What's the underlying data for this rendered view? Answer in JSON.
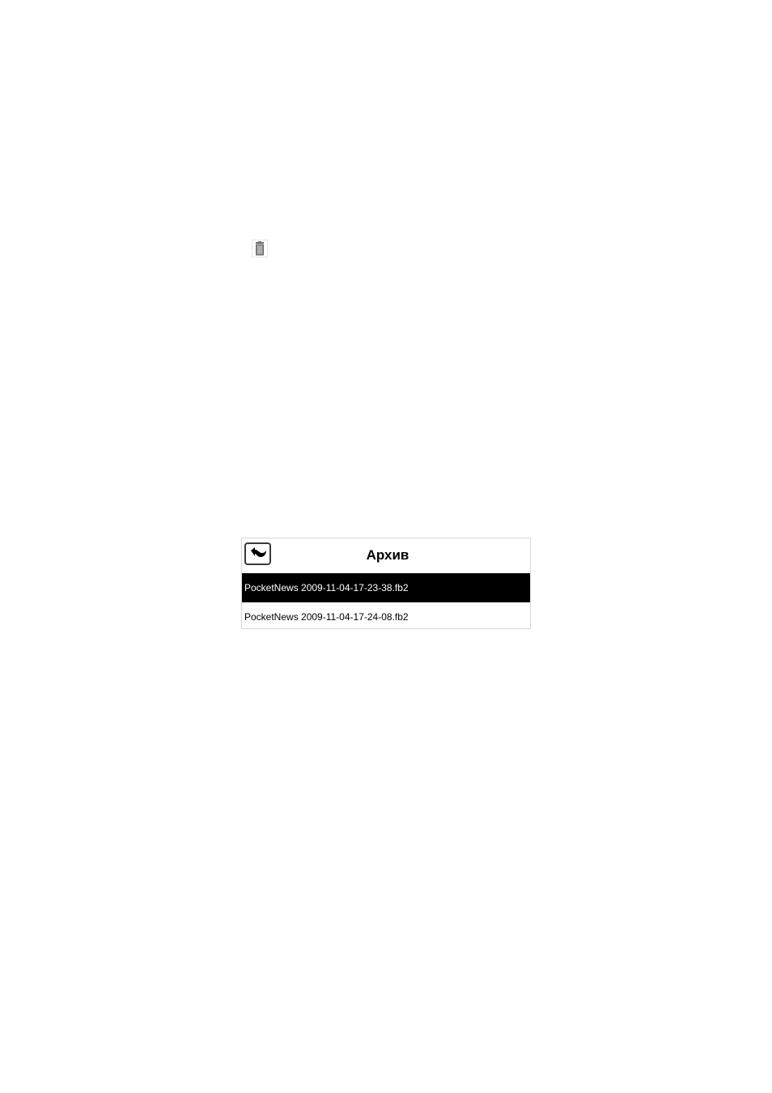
{
  "toolbar": {
    "delete_icon": "trash-icon"
  },
  "archive": {
    "title": "Архив",
    "back_icon": "back-arrow-icon",
    "files": [
      {
        "name": "PocketNews 2009-11-04-17-23-38.fb2",
        "selected": true
      },
      {
        "name": "PocketNews 2009-11-04-17-24-08.fb2",
        "selected": false
      }
    ]
  },
  "colors": {
    "selected_bg": "#000000",
    "selected_fg": "#ffffff",
    "text": "#000000",
    "panel_border": "#d8d8d8"
  }
}
